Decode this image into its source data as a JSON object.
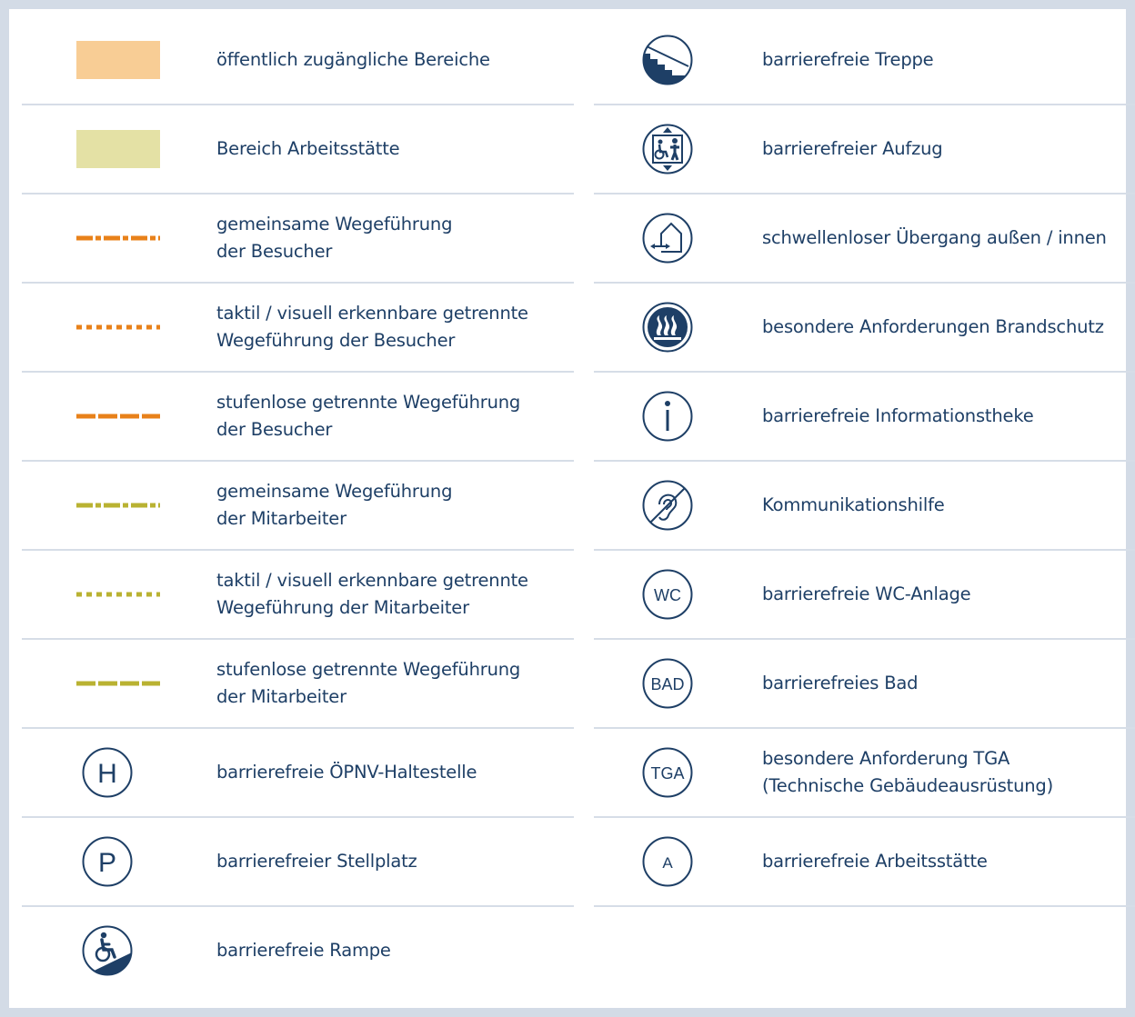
{
  "colors": {
    "navy": "#1e3f66",
    "orange": "#e8811a",
    "olive": "#b9b232",
    "swatch_public": "#f8cd95",
    "swatch_work": "#e4e1a5",
    "frame": "#d3dbe6",
    "divider": "#d6dde7"
  },
  "legend_left": [
    {
      "symbol": "swatch-orange",
      "lines": [
        "öffentlich zugängliche Bereiche"
      ]
    },
    {
      "symbol": "swatch-yellow",
      "lines": [
        "Bereich Arbeitsstätte"
      ]
    },
    {
      "symbol": "line-orange-dashdot",
      "lines": [
        "gemeinsame Wegeführung",
        "der Besucher"
      ]
    },
    {
      "symbol": "line-orange-dotted",
      "lines": [
        "taktil / visuell erkennbare getrennte",
        "Wegeführung der Besucher"
      ]
    },
    {
      "symbol": "line-orange-dashed",
      "lines": [
        "stufenlose getrennte Wegeführung",
        "der Besucher"
      ]
    },
    {
      "symbol": "line-olive-dashdot",
      "lines": [
        "gemeinsame Wegeführung",
        "der Mitarbeiter"
      ]
    },
    {
      "symbol": "line-olive-dotted",
      "lines": [
        "taktil / visuell erkennbare getrennte",
        "Wegeführung der Mitarbeiter"
      ]
    },
    {
      "symbol": "line-olive-dashed",
      "lines": [
        "stufenlose getrennte Wegeführung",
        "der Mitarbeiter"
      ]
    },
    {
      "symbol": "circle-letter",
      "symbol_text": "H",
      "lines": [
        "barrierefreie ÖPNV-Haltestelle"
      ]
    },
    {
      "symbol": "circle-letter",
      "symbol_text": "P",
      "lines": [
        "barrierefreier Stellplatz"
      ]
    },
    {
      "symbol": "wheelchair-ramp-icon",
      "lines": [
        "barrierefreie Rampe"
      ]
    }
  ],
  "legend_right": [
    {
      "symbol": "stairs-icon",
      "lines": [
        "barrierefreie Treppe"
      ]
    },
    {
      "symbol": "elevator-icon",
      "lines": [
        "barrierefreier Aufzug"
      ]
    },
    {
      "symbol": "threshold-free-icon",
      "lines": [
        "schwellenloser Übergang außen / innen"
      ]
    },
    {
      "symbol": "fire-protection-icon",
      "lines": [
        "besondere Anforderungen Brandschutz"
      ]
    },
    {
      "symbol": "info-icon",
      "lines": [
        "barrierefreie Informationstheke"
      ]
    },
    {
      "symbol": "hearing-aid-icon",
      "lines": [
        "Kommunikationshilfe"
      ]
    },
    {
      "symbol": "circle-letter",
      "symbol_text": "WC",
      "lines": [
        "barrierefreie WC-Anlage"
      ]
    },
    {
      "symbol": "circle-letter",
      "symbol_text": "BAD",
      "lines": [
        "barrierefreies Bad"
      ]
    },
    {
      "symbol": "circle-letter",
      "symbol_text": "TGA",
      "lines": [
        "besondere Anforderung TGA",
        "(Technische Gebäudeausrüstung)"
      ]
    },
    {
      "symbol": "circle-letter",
      "symbol_text": "A",
      "lines": [
        "barrierefreie Arbeitsstätte"
      ]
    }
  ]
}
